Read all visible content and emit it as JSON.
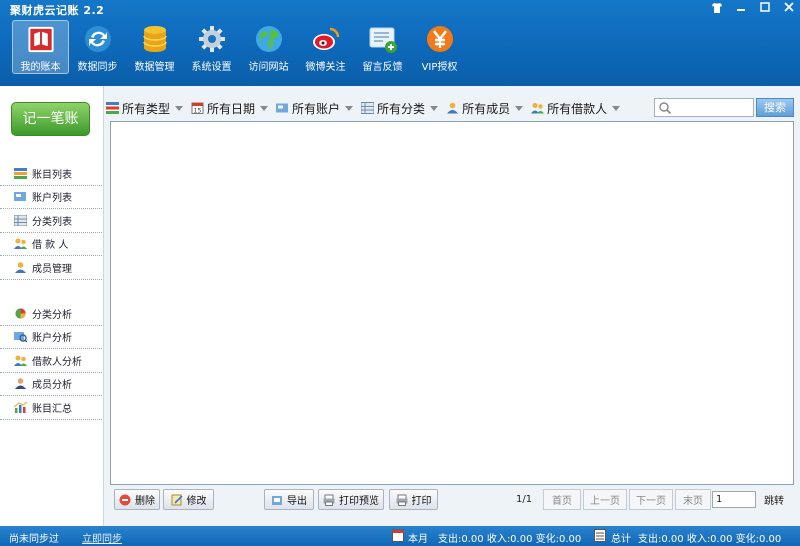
{
  "app": {
    "title": "聚财虎云记账 2.2"
  },
  "window_controls": [
    "shirt-icon",
    "minimize-icon",
    "maximize-icon",
    "close-icon"
  ],
  "toolbar": {
    "items": [
      {
        "label": "我的账本",
        "icon": "book-icon",
        "active": true
      },
      {
        "label": "数据同步",
        "icon": "sync-icon"
      },
      {
        "label": "数据管理",
        "icon": "database-icon"
      },
      {
        "label": "系统设置",
        "icon": "gear-icon"
      },
      {
        "label": "访问网站",
        "icon": "globe-icon"
      },
      {
        "label": "微博关注",
        "icon": "weibo-icon"
      },
      {
        "label": "留言反馈",
        "icon": "feedback-icon"
      },
      {
        "label": "VIP授权",
        "icon": "yen-icon"
      }
    ]
  },
  "sidebar": {
    "record_button": "记一笔账",
    "lists": [
      {
        "label": "账目列表",
        "icon": "ledger-list-icon"
      },
      {
        "label": "账户列表",
        "icon": "account-list-icon"
      },
      {
        "label": "分类列表",
        "icon": "category-list-icon"
      },
      {
        "label": "借 款 人",
        "icon": "borrower-icon"
      },
      {
        "label": "成员管理",
        "icon": "member-icon"
      }
    ],
    "analysis": [
      {
        "label": "分类分析",
        "icon": "pie-chart-icon"
      },
      {
        "label": "账户分析",
        "icon": "account-analysis-icon"
      },
      {
        "label": "借款人分析",
        "icon": "borrower-analysis-icon"
      },
      {
        "label": "成员分析",
        "icon": "member-analysis-icon"
      },
      {
        "label": "账目汇总",
        "icon": "summary-chart-icon"
      }
    ]
  },
  "filters": [
    {
      "label": "所有类型",
      "icon": "type-icon"
    },
    {
      "label": "所有日期",
      "icon": "calendar-icon"
    },
    {
      "label": "所有账户",
      "icon": "account-icon"
    },
    {
      "label": "所有分类",
      "icon": "category-icon"
    },
    {
      "label": "所有成员",
      "icon": "member-icon"
    },
    {
      "label": "所有借款人",
      "icon": "borrower-icon"
    }
  ],
  "search": {
    "placeholder": "",
    "button": "搜索"
  },
  "actions": {
    "delete": "删除",
    "edit": "修改",
    "export": "导出",
    "print_preview": "打印预览",
    "print": "打印"
  },
  "pager": {
    "page_info": "1/1",
    "first": "首页",
    "prev": "上一页",
    "next": "下一页",
    "last": "末页",
    "page_value": "1",
    "jump": "跳转"
  },
  "status": {
    "sync_state": "尚未同步过",
    "sync_link": "立即同步",
    "month_label": "本月",
    "month_values": "支出:0.00  收入:0.00  变化:0.00",
    "total_label": "总计",
    "total_values": "支出:0.00  收入:0.00  变化:0.00"
  },
  "colors": {
    "title_blue": "#0f6bbd",
    "record_green": "#4caf34",
    "status_blue": "#1b72c0"
  }
}
